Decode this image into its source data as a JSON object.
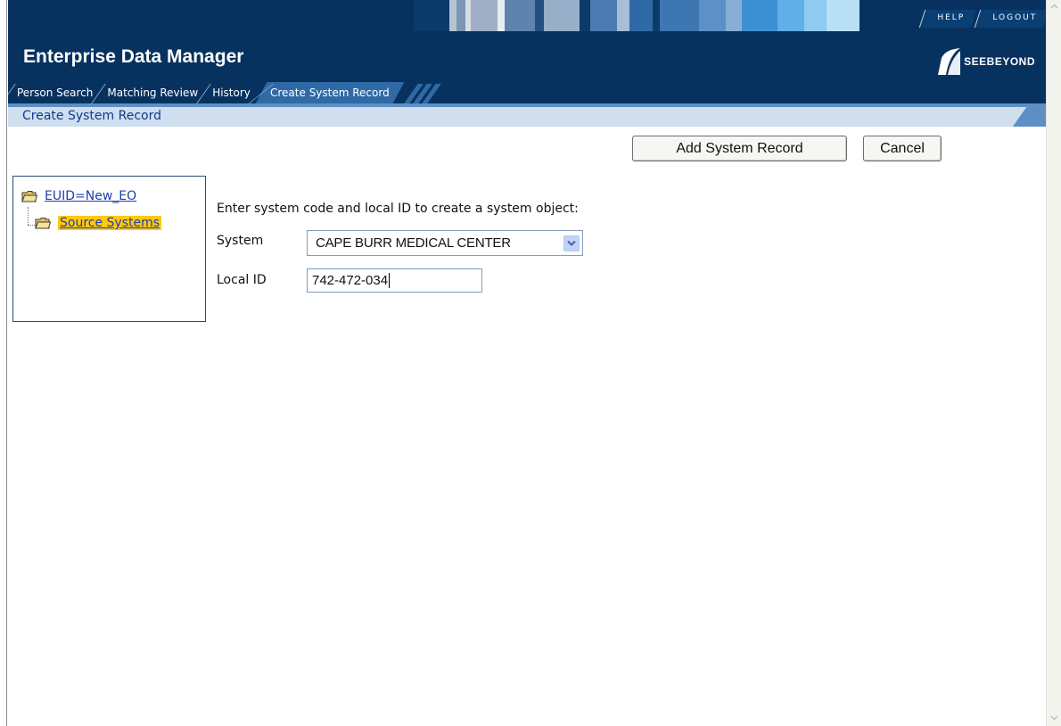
{
  "app": {
    "title": "Enterprise Data Manager",
    "logo_text": "SEEBEYOND",
    "top_links": [
      "HELP",
      "LOGOUT"
    ]
  },
  "tabs": [
    {
      "label": "Person Search",
      "active": false
    },
    {
      "label": "Matching Review",
      "active": false
    },
    {
      "label": "History",
      "active": false
    },
    {
      "label": "Create System Record",
      "active": true
    }
  ],
  "breadcrumb": "Create System Record",
  "actions": {
    "add_label": "Add System Record",
    "cancel_label": "Cancel"
  },
  "tree": {
    "root_label": "EUID=New_EO",
    "child_label": "Source Systems"
  },
  "form": {
    "instruction": "Enter system code and local ID to create a system object:",
    "system_label": "System",
    "system_value": "CAPE BURR MEDICAL CENTER",
    "local_id_label": "Local ID",
    "local_id_value": "742-472-034"
  },
  "colors": {
    "header_bg": "#07325f",
    "tab_active": "#2f6aa6",
    "breadcrumb_light": "#cfdff0",
    "selected_highlight": "#ffc90e",
    "link": "#1d3fb0"
  },
  "icons": {
    "folder": "folder-icon",
    "dropdown": "chevron-down-icon",
    "scroll_up": "scroll-up-icon",
    "scroll_down": "scroll-down-icon"
  }
}
